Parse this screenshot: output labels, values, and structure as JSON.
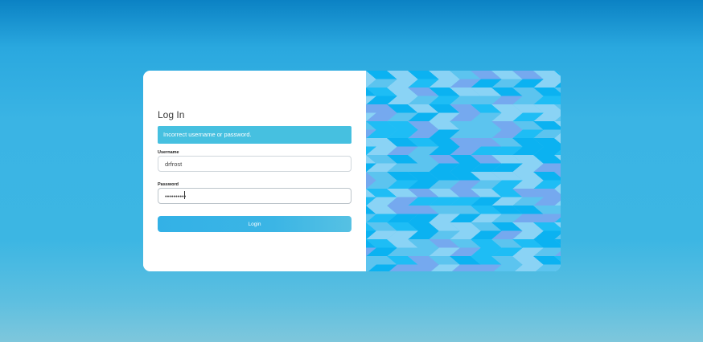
{
  "login": {
    "title": "Log In",
    "error_message": "Incorrect username or password.",
    "username_label": "Username",
    "username_value": "drfrost",
    "password_label": "Password",
    "password_value": "••••••••••",
    "login_button_label": "Login"
  },
  "colors": {
    "accent": "#3bb5e5",
    "alert_background": "#46c0e0",
    "card_background": "#ffffff"
  },
  "decoration": {
    "pattern": "chevron-arrows",
    "pattern_colors": [
      "#0bb2f1",
      "#5cc4ef",
      "#8ad3f5",
      "#75a9ef",
      "#1ebdf5"
    ]
  }
}
